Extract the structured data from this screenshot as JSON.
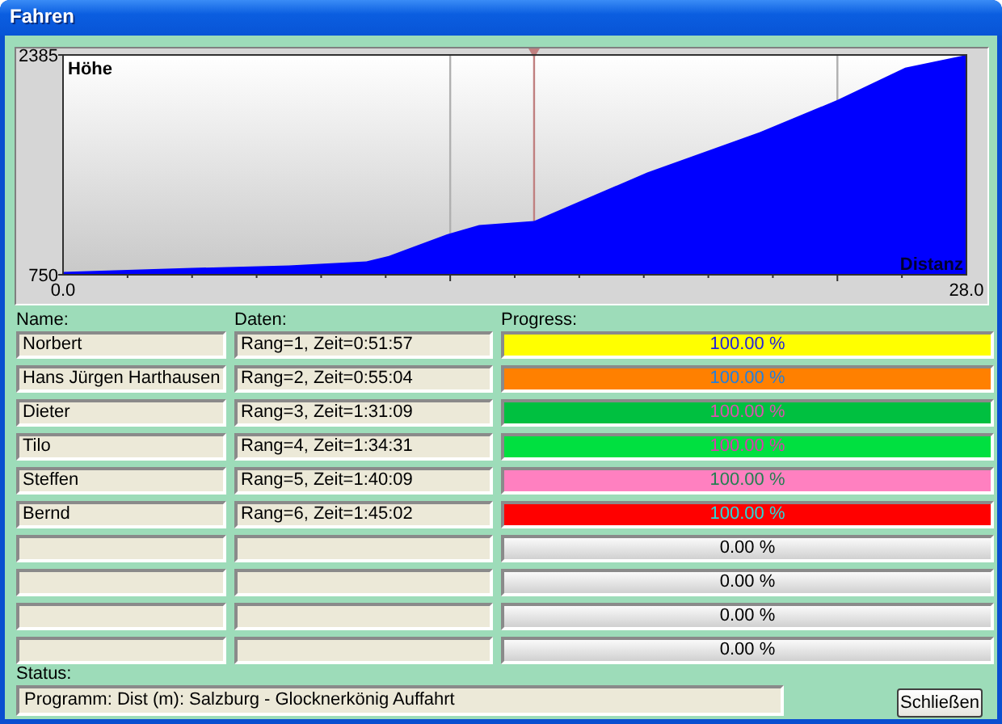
{
  "window": {
    "title": "Fahren"
  },
  "profile": {
    "chart_data": {
      "type": "area",
      "xlabel": "Distanz",
      "ylabel": "Höhe",
      "x": [
        0,
        4,
        7,
        9.4,
        10.1,
        11.9,
        12.9,
        14.6,
        18.1,
        21.6,
        24,
        26.1,
        28
      ],
      "series": [
        {
          "color": "#0000ff",
          "values": [
            770,
            800,
            820,
            850,
            890,
            1050,
            1120,
            1150,
            1510,
            1810,
            2050,
            2290,
            2385
          ]
        }
      ],
      "xlim": [
        0,
        28
      ],
      "ylim": [
        750,
        2385
      ],
      "xticks": [
        {
          "value": 0,
          "label": "0.0"
        },
        {
          "value": 28,
          "label": "28.0"
        }
      ],
      "yticks": [
        {
          "value": 750,
          "label": "750"
        },
        {
          "value": 2385,
          "label": "2385"
        }
      ],
      "ref_lines": [
        {
          "axis": "x",
          "value": 12,
          "color": "#b0b0b0"
        },
        {
          "axis": "x",
          "value": 24,
          "color": "#b0b0b0"
        },
        {
          "axis": "x",
          "value": 14.6,
          "color": "#c08080"
        }
      ]
    }
  },
  "columns": {
    "name": "Name:",
    "data": "Daten:",
    "progress": "Progress:"
  },
  "players": [
    {
      "name": "Norbert",
      "data": "Rang=1, Zeit=0:51:57",
      "progress": "100.00 %",
      "level": 1,
      "color": "#ffff00"
    },
    {
      "name": "Hans Jürgen Harthausen",
      "data": "Rang=2, Zeit=0:55:04",
      "progress": "100.00 %",
      "level": 1,
      "color": "#ff8000"
    },
    {
      "name": "Dieter",
      "data": "Rang=3, Zeit=1:31:09",
      "progress": "100.00 %",
      "level": 1,
      "color": "#00c040"
    },
    {
      "name": "Tilo",
      "data": "Rang=4, Zeit=1:34:31",
      "progress": "100.00 %",
      "level": 1,
      "color": "#00e040"
    },
    {
      "name": "Steffen",
      "data": "Rang=5, Zeit=1:40:09",
      "progress": "100.00 %",
      "level": 1,
      "color": "#ff80c0"
    },
    {
      "name": "Bernd",
      "data": "Rang=6, Zeit=1:45:02",
      "progress": "100.00 %",
      "level": 1,
      "color": "#ff0000"
    },
    {
      "progress": "0.00 %",
      "level": 0
    },
    {
      "progress": "0.00 %",
      "level": 0
    },
    {
      "progress": "0.00 %",
      "level": 0
    },
    {
      "progress": "0.00 %",
      "level": 0
    }
  ],
  "status": {
    "label": "Status:",
    "value": "Programm: Dist (m): Salzburg - Glocknerkönig Auffahrt"
  },
  "buttons": [
    {
      "label": "Schließen"
    }
  ]
}
